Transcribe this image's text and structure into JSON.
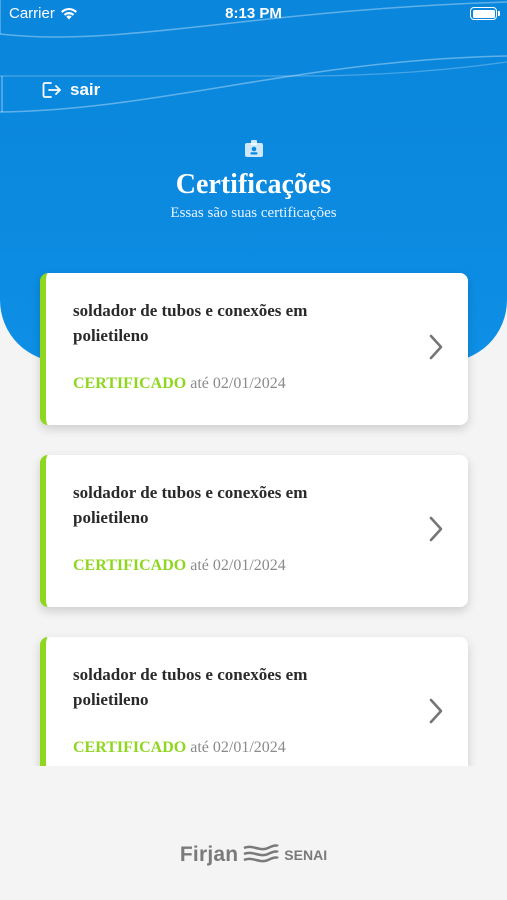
{
  "status_bar": {
    "carrier": "Carrier",
    "time": "8:13 PM"
  },
  "header": {
    "logout_label": "sair",
    "title": "Certificações",
    "subtitle": "Essas são suas certificações",
    "color": "#0b8ae0"
  },
  "certifications": [
    {
      "course": "soldador de tubos e conexões em polietileno",
      "status": "CERTIFICADO",
      "until": "até 02/01/2024"
    },
    {
      "course": "soldador de tubos e conexões em polietileno",
      "status": "CERTIFICADO",
      "until": "até 02/01/2024"
    },
    {
      "course": "soldador de tubos e conexões em polietileno",
      "status": "CERTIFICADO",
      "until": "até 02/01/2024"
    }
  ],
  "footer": {
    "logo_left": "Firjan",
    "logo_right": "SENAI"
  },
  "icons": {
    "logout": "logout-icon",
    "badge": "certificate-badge-icon",
    "chevron": "chevron-right-icon",
    "wifi": "wifi-icon",
    "battery": "battery-icon"
  },
  "colors": {
    "accent": "#8fd61f",
    "header_blue": "#0b8ae0",
    "text": "#2a2a2a",
    "muted": "#8a8a8a"
  }
}
